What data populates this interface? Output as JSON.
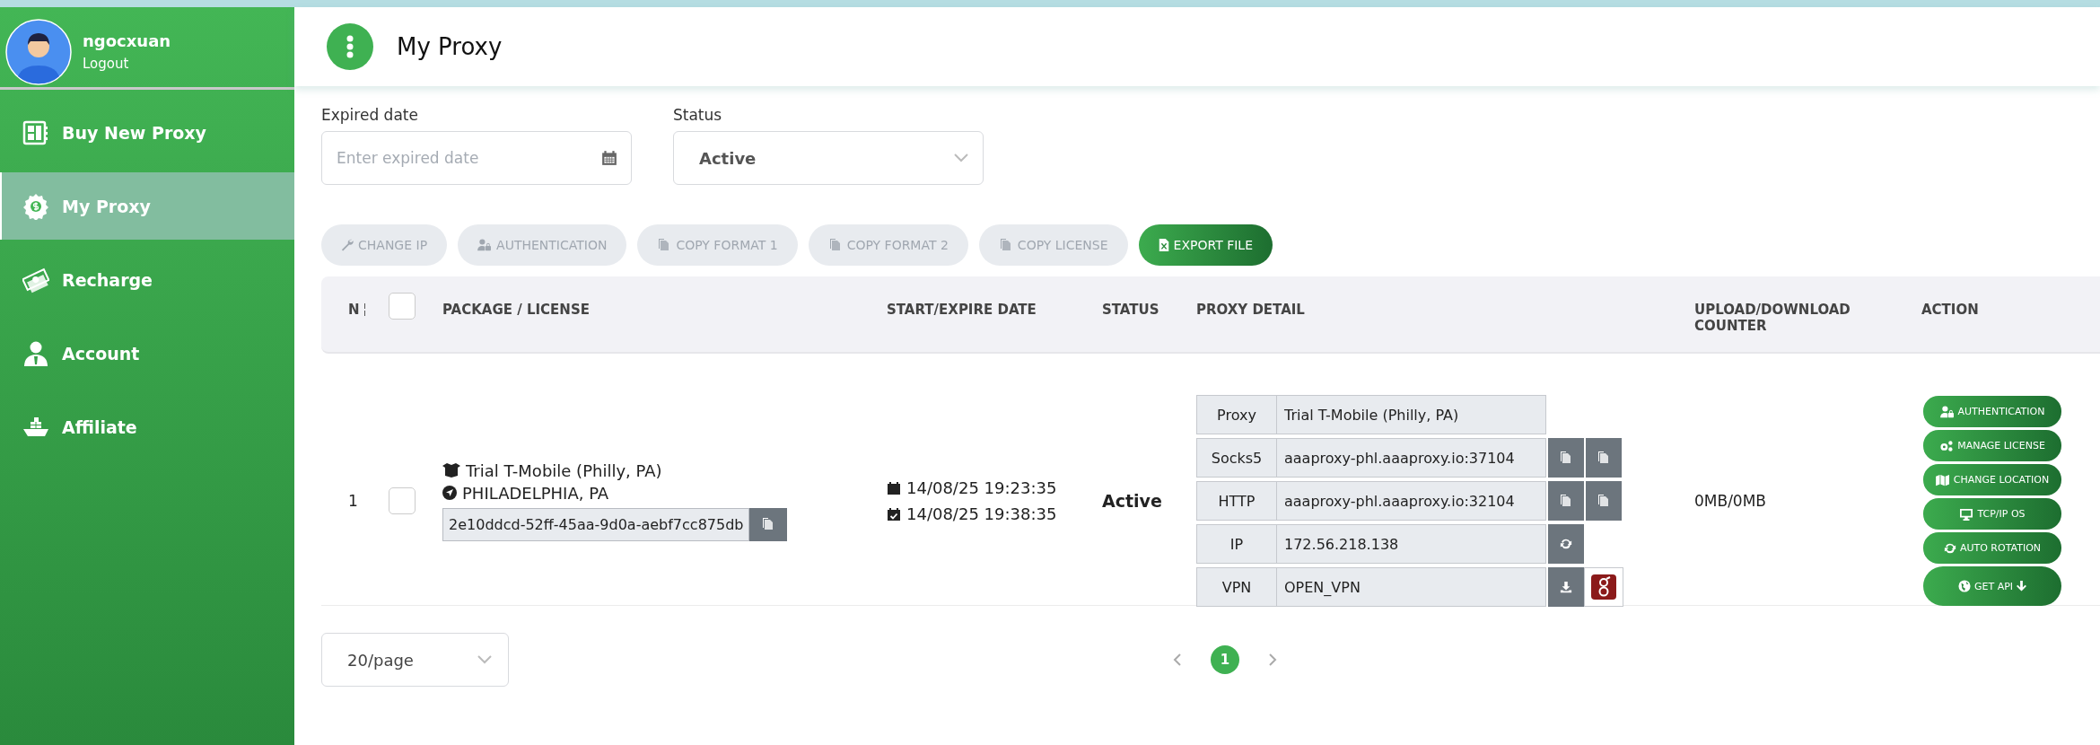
{
  "user": {
    "name": "ngocxuan",
    "logout": "Logout"
  },
  "sidebar": {
    "items": [
      {
        "label": "Buy New Proxy",
        "selected": false
      },
      {
        "label": "My Proxy",
        "selected": true
      },
      {
        "label": "Recharge",
        "selected": false
      },
      {
        "label": "Account",
        "selected": false
      },
      {
        "label": "Affiliate",
        "selected": false
      }
    ]
  },
  "header": {
    "title": "My Proxy"
  },
  "filters": {
    "expired_date": {
      "label": "Expired date",
      "placeholder": "Enter expired date"
    },
    "status": {
      "label": "Status",
      "value": "Active"
    }
  },
  "toolbar": [
    {
      "label": "CHANGE IP",
      "disabled": true
    },
    {
      "label": "AUTHENTICATION",
      "disabled": true
    },
    {
      "label": "COPY FORMAT 1",
      "disabled": true
    },
    {
      "label": "COPY FORMAT 2",
      "disabled": true
    },
    {
      "label": "COPY LICENSE",
      "disabled": true
    },
    {
      "label": "EXPORT FILE",
      "disabled": false
    }
  ],
  "table": {
    "select_all_checked": false,
    "columns": [
      "N",
      "PACKAGE / LICENSE",
      "START/EXPIRE DATE",
      "STATUS",
      "PROXY DETAIL",
      "UPLOAD/DOWNLOAD COUNTER",
      "ACTION"
    ],
    "rows": [
      {
        "no": "1",
        "checked": false,
        "package": "Trial T-Mobile (Philly, PA)",
        "location": "PHILADELPHIA, PA",
        "license": "2e10ddcd-52ff-45aa-9d0a-aebf7cc875db",
        "start": "14/08/25 19:23:35",
        "expire": "14/08/25 19:38:35",
        "status": "Active",
        "proxy_detail": [
          {
            "kind": "plain",
            "label": "Proxy",
            "value": "Trial T-Mobile (Philly, PA)"
          },
          {
            "kind": "endpoint",
            "label": "Socks5",
            "value": "aaaproxy-phl.aaaproxy.io:37104"
          },
          {
            "kind": "endpoint",
            "label": "HTTP",
            "value": "aaaproxy-phl.aaaproxy.io:32104"
          },
          {
            "kind": "ip",
            "label": "IP",
            "value": "172.56.218.138"
          },
          {
            "kind": "vpn",
            "label": "VPN",
            "value": "OPEN_VPN"
          }
        ],
        "counter": "0MB/0MB",
        "actions": [
          "AUTHENTICATION",
          "MANAGE LICENSE",
          "CHANGE LOCATION",
          "TCP/IP OS",
          "AUTO ROTATION",
          "GET API"
        ]
      }
    ]
  },
  "pagination": {
    "per_page": "20/page",
    "pages": [
      {
        "label": "1",
        "selected": true
      }
    ]
  }
}
